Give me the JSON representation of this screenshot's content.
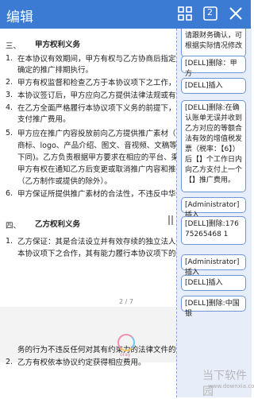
{
  "header": {
    "title": "编辑",
    "page_badge": "2"
  },
  "doc": {
    "section3_heading_num": "三、",
    "section3_heading": "甲方权利义务",
    "items3": [
      {
        "num": "1.",
        "lines": [
          "在本协议有效期间，甲方有权与乙方协商后指定推",
          "确定的推广排期执行。"
        ]
      },
      {
        "num": "2.",
        "lines": [
          "甲方有权监督和检查乙方于本协议项下之工作，并"
        ]
      },
      {
        "num": "3.",
        "lines": [
          "本协议签订后，甲方应向乙方提供法律法规或有关部"
        ]
      },
      {
        "num": "4.",
        "lines": [
          "在乙方全面严格履行本协议项下义务的前提下，甲方",
          "支付推广费用。"
        ]
      },
      {
        "num": "5.",
        "lines": [
          "甲方应在推广内容投放前向乙方提供推广素材（包括",
          "商标、logo、产品介绍、图文、音视频、文稿等，具体",
          "下同)。乙方负责根据甲方要求在相应的平台、渠道、",
          "甲方有权在通知乙方后变更或取消推广内容和推广排期",
          "（乙方制作或提供的除外）。"
        ]
      },
      {
        "num": "6.",
        "lines": [
          "甲方保证所提供推广素材的合法性，不违反中华人民"
        ]
      }
    ],
    "section4_heading_num": "四、",
    "section4_heading": "乙方权利义务",
    "items4": [
      {
        "num": "1.",
        "lines": [
          "乙方保证：其是合法设立并有效存续的独立法人，有",
          "本协议项下之合作，其有能力履行本协议项下的"
        ]
      }
    ],
    "page_indicator": "2 / 7",
    "bottom_lines": [
      "务的行为不违反任何对其有约束力的法律文件的规制",
      "乙方有权依本协议约定获得相应费用。"
    ],
    "bottom_num": "2."
  },
  "spinner_label": "oray",
  "comments": [
    "请跟财务确认，可根据实际情况修改",
    "[DELL]删除：甲方",
    "[DELL]插入",
    "[DELL]删除:在确认账单无误并收到乙方对应的等额合法有效的增值税发票（税率：【6】）后【】个工作日内向乙方支付上一个【】推广费用。",
    "[Administrator]插入",
    "[DELL]删除:17675265468 1",
    "[Administrator]插入",
    "[DELL]插入",
    "[DELL]删除:中国银"
  ],
  "watermark": {
    "text": "当下软件园",
    "url": "www.downxia.com"
  }
}
